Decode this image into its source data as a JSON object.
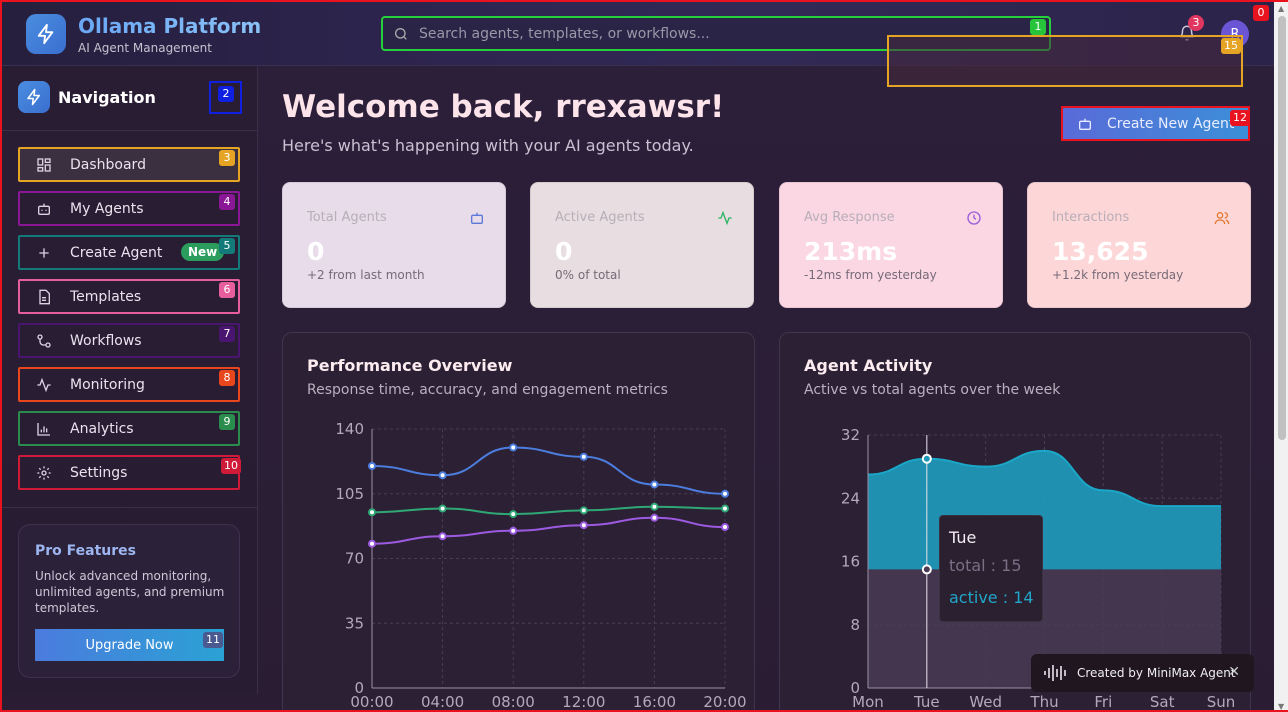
{
  "header": {
    "title": "Ollama Platform",
    "subtitle": "AI Agent Management",
    "search_placeholder": "Search agents, templates, or workflows...",
    "notification_count": "3",
    "avatar_initial": "R"
  },
  "annotations": {
    "root": "0",
    "search": "1",
    "nav_head": "2",
    "dashboard": "3",
    "my_agents": "4",
    "create_agent": "5",
    "templates": "6",
    "workflows": "7",
    "monitoring": "8",
    "analytics": "9",
    "settings": "10",
    "upgrade": "11",
    "create_btn": "12",
    "dropdown": "15"
  },
  "sidebar": {
    "heading": "Navigation",
    "items": [
      {
        "label": "Dashboard",
        "icon": "dashboard-icon"
      },
      {
        "label": "My Agents",
        "icon": "bot-icon"
      },
      {
        "label": "Create Agent",
        "icon": "plus-icon",
        "pill": "New"
      },
      {
        "label": "Templates",
        "icon": "document-icon"
      },
      {
        "label": "Workflows",
        "icon": "workflow-icon"
      },
      {
        "label": "Monitoring",
        "icon": "activity-icon"
      },
      {
        "label": "Analytics",
        "icon": "bar-chart-icon"
      },
      {
        "label": "Settings",
        "icon": "gear-icon"
      }
    ],
    "pro": {
      "title": "Pro Features",
      "description": "Unlock advanced monitoring, unlimited agents, and premium templates.",
      "button": "Upgrade Now"
    }
  },
  "main": {
    "welcome": "Welcome back, rrexawsr!",
    "welcome_sub": "Here's what's happening with your AI agents today.",
    "create_button": "Create New Agent",
    "stats": [
      {
        "title": "Total Agents",
        "value": "0",
        "sub": "+2 from last month",
        "icon": "bot-icon",
        "color": "#e8dcea",
        "icon_color": "#5b78d8"
      },
      {
        "title": "Active Agents",
        "value": "0",
        "sub": "0% of total",
        "icon": "activity-icon",
        "color": "#e8dde0",
        "icon_color": "#2bb563"
      },
      {
        "title": "Avg Response",
        "value": "213ms",
        "sub": "-12ms from yesterday",
        "icon": "clock-icon",
        "color": "#fbd7e3",
        "icon_color": "#9b5bd8"
      },
      {
        "title": "Interactions",
        "value": "13,625",
        "sub": "+1.2k from yesterday",
        "icon": "users-icon",
        "color": "#fdd7d8",
        "icon_color": "#e2772f"
      }
    ]
  },
  "chart_data": [
    {
      "type": "line",
      "title": "Performance Overview",
      "subtitle": "Response time, accuracy, and engagement metrics",
      "x": [
        "00:00",
        "04:00",
        "08:00",
        "12:00",
        "16:00",
        "20:00"
      ],
      "yticks": [
        "0",
        "35",
        "70",
        "105",
        "140"
      ],
      "ylim": [
        0,
        140
      ],
      "grid": true,
      "series": [
        {
          "values": [
            120,
            115,
            130,
            125,
            110,
            105
          ],
          "color": "#4c7ee0"
        },
        {
          "values": [
            95,
            97,
            94,
            96,
            98,
            97
          ],
          "color": "#2fa876"
        },
        {
          "values": [
            78,
            82,
            85,
            88,
            92,
            87
          ],
          "color": "#9b5ae0"
        }
      ]
    },
    {
      "type": "area",
      "title": "Agent Activity",
      "subtitle": "Active vs total agents over the week",
      "categories": [
        "Mon",
        "Tue",
        "Wed",
        "Thu",
        "Fri",
        "Sat",
        "Sun"
      ],
      "yticks": [
        "0",
        "8",
        "16",
        "24",
        "32"
      ],
      "ylim": [
        0,
        32
      ],
      "grid": true,
      "series": [
        {
          "name": "total",
          "values": [
            15,
            15,
            15,
            15,
            15,
            15,
            15
          ],
          "color": "#4a3b55"
        },
        {
          "name": "active",
          "values": [
            12,
            14,
            13,
            15,
            10,
            8,
            8
          ],
          "color": "#1f97b6"
        }
      ],
      "tooltip": {
        "label": "Tue",
        "total": "total : 15",
        "active": "active : 14"
      }
    }
  ],
  "toast": {
    "text": "Created by MiniMax Agent"
  }
}
